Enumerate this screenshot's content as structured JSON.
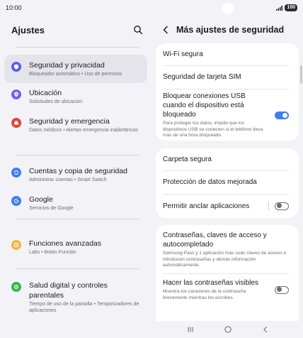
{
  "status": {
    "time": "10:00",
    "battery": "100"
  },
  "left": {
    "title": "Ajustes",
    "items": [
      {
        "label": "Seguridad y privacidad",
        "sub": "Bloqueador automático • Uso de permisos",
        "color": "#5a5df0",
        "icon": "shield-icon"
      },
      {
        "label": "Ubicación",
        "sub": "Solicitudes de ubicación",
        "color": "#7c5cf0",
        "icon": "location-pin-icon"
      },
      {
        "label": "Seguridad y emergencia",
        "sub": "Datos médicos • Alertas emergencia inalámbricas",
        "color": "#e0453a",
        "icon": "emergency-icon"
      },
      {
        "label": "Cuentas y copia de seguridad",
        "sub": "Administrar cuentas • Smart Switch",
        "color": "#3f7ef5",
        "icon": "sync-icon"
      },
      {
        "label": "Google",
        "sub": "Servicios de Google",
        "color": "#3f7ef5",
        "icon": "google-icon"
      },
      {
        "label": "Funciones avanzadas",
        "sub": "Labs • Botón Función",
        "color": "#f3b43f",
        "icon": "advanced-features-icon"
      },
      {
        "label": "Salud digital y controles parentales",
        "sub": "Tiempo de uso de la pantalla • Temporizadores de aplicaciones",
        "color": "#36b24a",
        "icon": "digital-wellbeing-icon"
      }
    ]
  },
  "right": {
    "title": "Más ajustes de seguridad",
    "card1": {
      "wifi": "Wi-Fi segura",
      "sim": "Seguridad de tarjeta SIM",
      "usb_label": "Bloquear conexiones USB cuando el dispositivo está bloqueado",
      "usb_desc": "Para proteger tus datos, impide que los dispositivos USB se conecten si el teléfono lleva más de una hora bloqueado.",
      "usb_on": true
    },
    "card2": {
      "folder": "Carpeta segura",
      "data_protection": "Protección de datos mejorada",
      "pin_apps": "Permitir anclar aplicaciones",
      "pin_apps_on": false
    },
    "card3": {
      "passwords_label": "Contraseñas, claves de acceso y autocompletado",
      "passwords_desc": "Samsung Pass y 1 aplicación más usan claves de acceso e introducen contraseñas y demás información automáticamente.",
      "visible_label": "Hacer las contraseñas visibles",
      "visible_desc": "Muestra los caracteres de la contraseña brevemente mientras los escribes.",
      "visible_on": false
    }
  },
  "colors": {
    "accent": "#3e7bf6",
    "background": "#f3f3f7",
    "card": "#ffffff"
  }
}
